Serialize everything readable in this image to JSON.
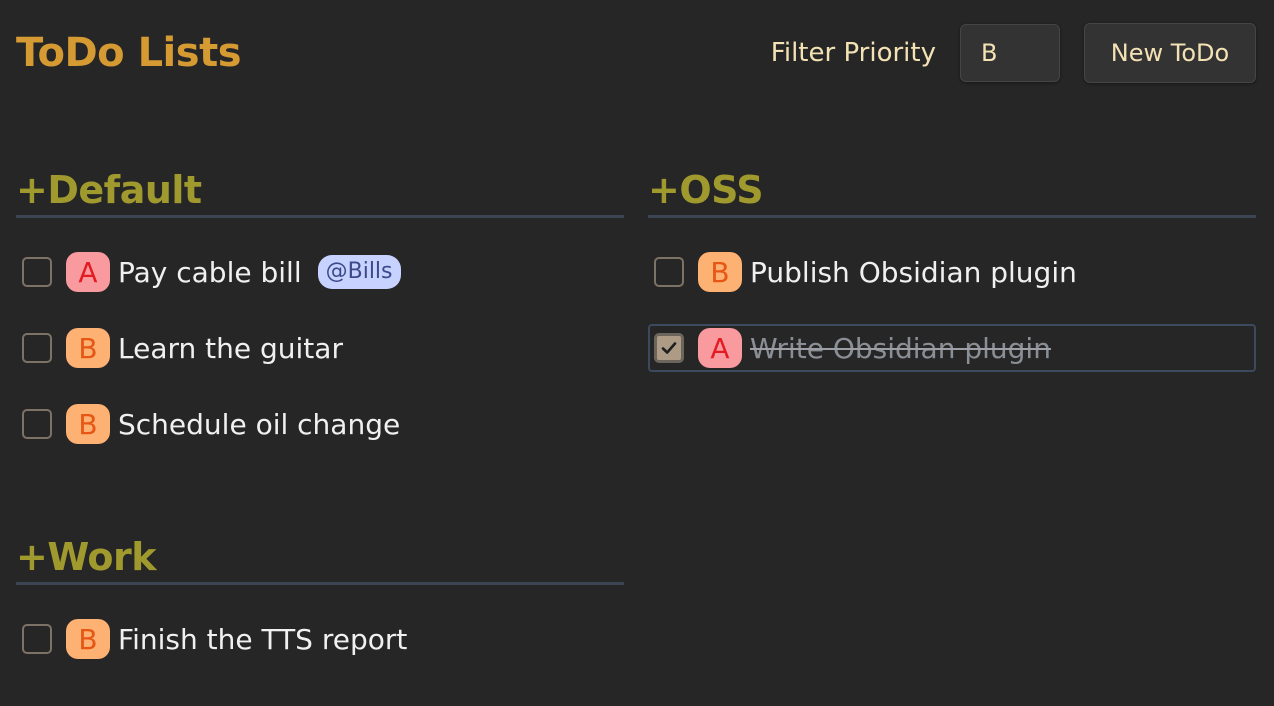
{
  "header": {
    "title": "ToDo Lists",
    "filter_label": "Filter Priority",
    "filter_value": "B",
    "new_button_label": "New ToDo"
  },
  "colors": {
    "title": "#d69a33",
    "section_title": "#a09a2e",
    "priority_A_bg": "#f99a9f",
    "priority_A_fg": "#e31b23",
    "priority_B_bg": "#fdb173",
    "priority_B_fg": "#e65614",
    "tag_bg": "#c7d2fe"
  },
  "sections": [
    {
      "title": "+Default",
      "items": [
        {
          "priority": "A",
          "text": "Pay cable bill",
          "tag": "@Bills",
          "done": false
        },
        {
          "priority": "B",
          "text": "Learn the guitar",
          "done": false
        },
        {
          "priority": "B",
          "text": "Schedule oil change",
          "done": false
        }
      ]
    },
    {
      "title": "+OSS",
      "items": [
        {
          "priority": "B",
          "text": "Publish Obsidian plugin",
          "done": false
        },
        {
          "priority": "A",
          "text": "Write Obsidian plugin",
          "done": true
        }
      ]
    },
    {
      "title": "+Work",
      "items": [
        {
          "priority": "B",
          "text": "Finish the TTS report",
          "done": false
        }
      ]
    }
  ]
}
